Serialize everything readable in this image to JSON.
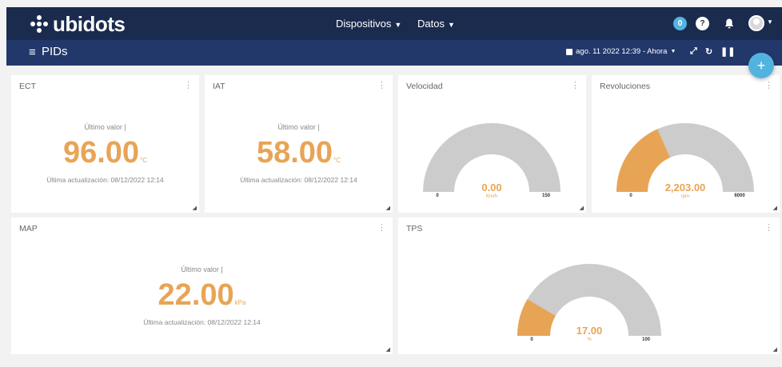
{
  "brand": "ubidots",
  "nav": {
    "devices": "Dispositivos",
    "data": "Datos"
  },
  "notifications": {
    "count": "0"
  },
  "header": {
    "menu_glyph": "≡",
    "title": "PIDs",
    "date_range": "ago. 11 2022 12:39 - Ahora"
  },
  "widgets": {
    "ect": {
      "title": "ECT",
      "label": "Último valor |",
      "value": "96.00",
      "unit": "°C",
      "updated": "Última actualización: 08/12/2022 12:14"
    },
    "iat": {
      "title": "IAT",
      "label": "Último valor |",
      "value": "58.00",
      "unit": "°C",
      "updated": "Última actualización: 08/12/2022 12:14"
    },
    "velocidad": {
      "title": "Velocidad",
      "value": 0,
      "value_text": "0.00",
      "unit": "Km/h",
      "min": 0,
      "max": 150,
      "min_text": "0",
      "max_text": "150"
    },
    "revoluciones": {
      "title": "Revoluciones",
      "value": 2203,
      "value_text": "2,203.00",
      "unit": "rpm",
      "min": 0,
      "max": 6000,
      "min_text": "0",
      "max_text": "6000"
    },
    "map": {
      "title": "MAP",
      "label": "Último valor |",
      "value": "22.00",
      "unit": "kPa",
      "updated": "Última actualización: 08/12/2022 12:14"
    },
    "tps": {
      "title": "TPS",
      "value": 17,
      "value_text": "17.00",
      "unit": "%",
      "min": 0,
      "max": 100,
      "min_text": "0",
      "max_text": "100"
    }
  },
  "colors": {
    "accent": "#e8a455",
    "gauge_bg": "#cccccc",
    "navy": "#1a2b4e",
    "subbar": "#22376a",
    "blue": "#53b3e0"
  },
  "icons": [
    "ubidots-logo",
    "calendar-icon",
    "expand-icon",
    "refresh-icon",
    "pause-icon",
    "bell-icon",
    "help-icon",
    "add-icon",
    "kebab-menu-icon",
    "resize-handle-icon"
  ]
}
